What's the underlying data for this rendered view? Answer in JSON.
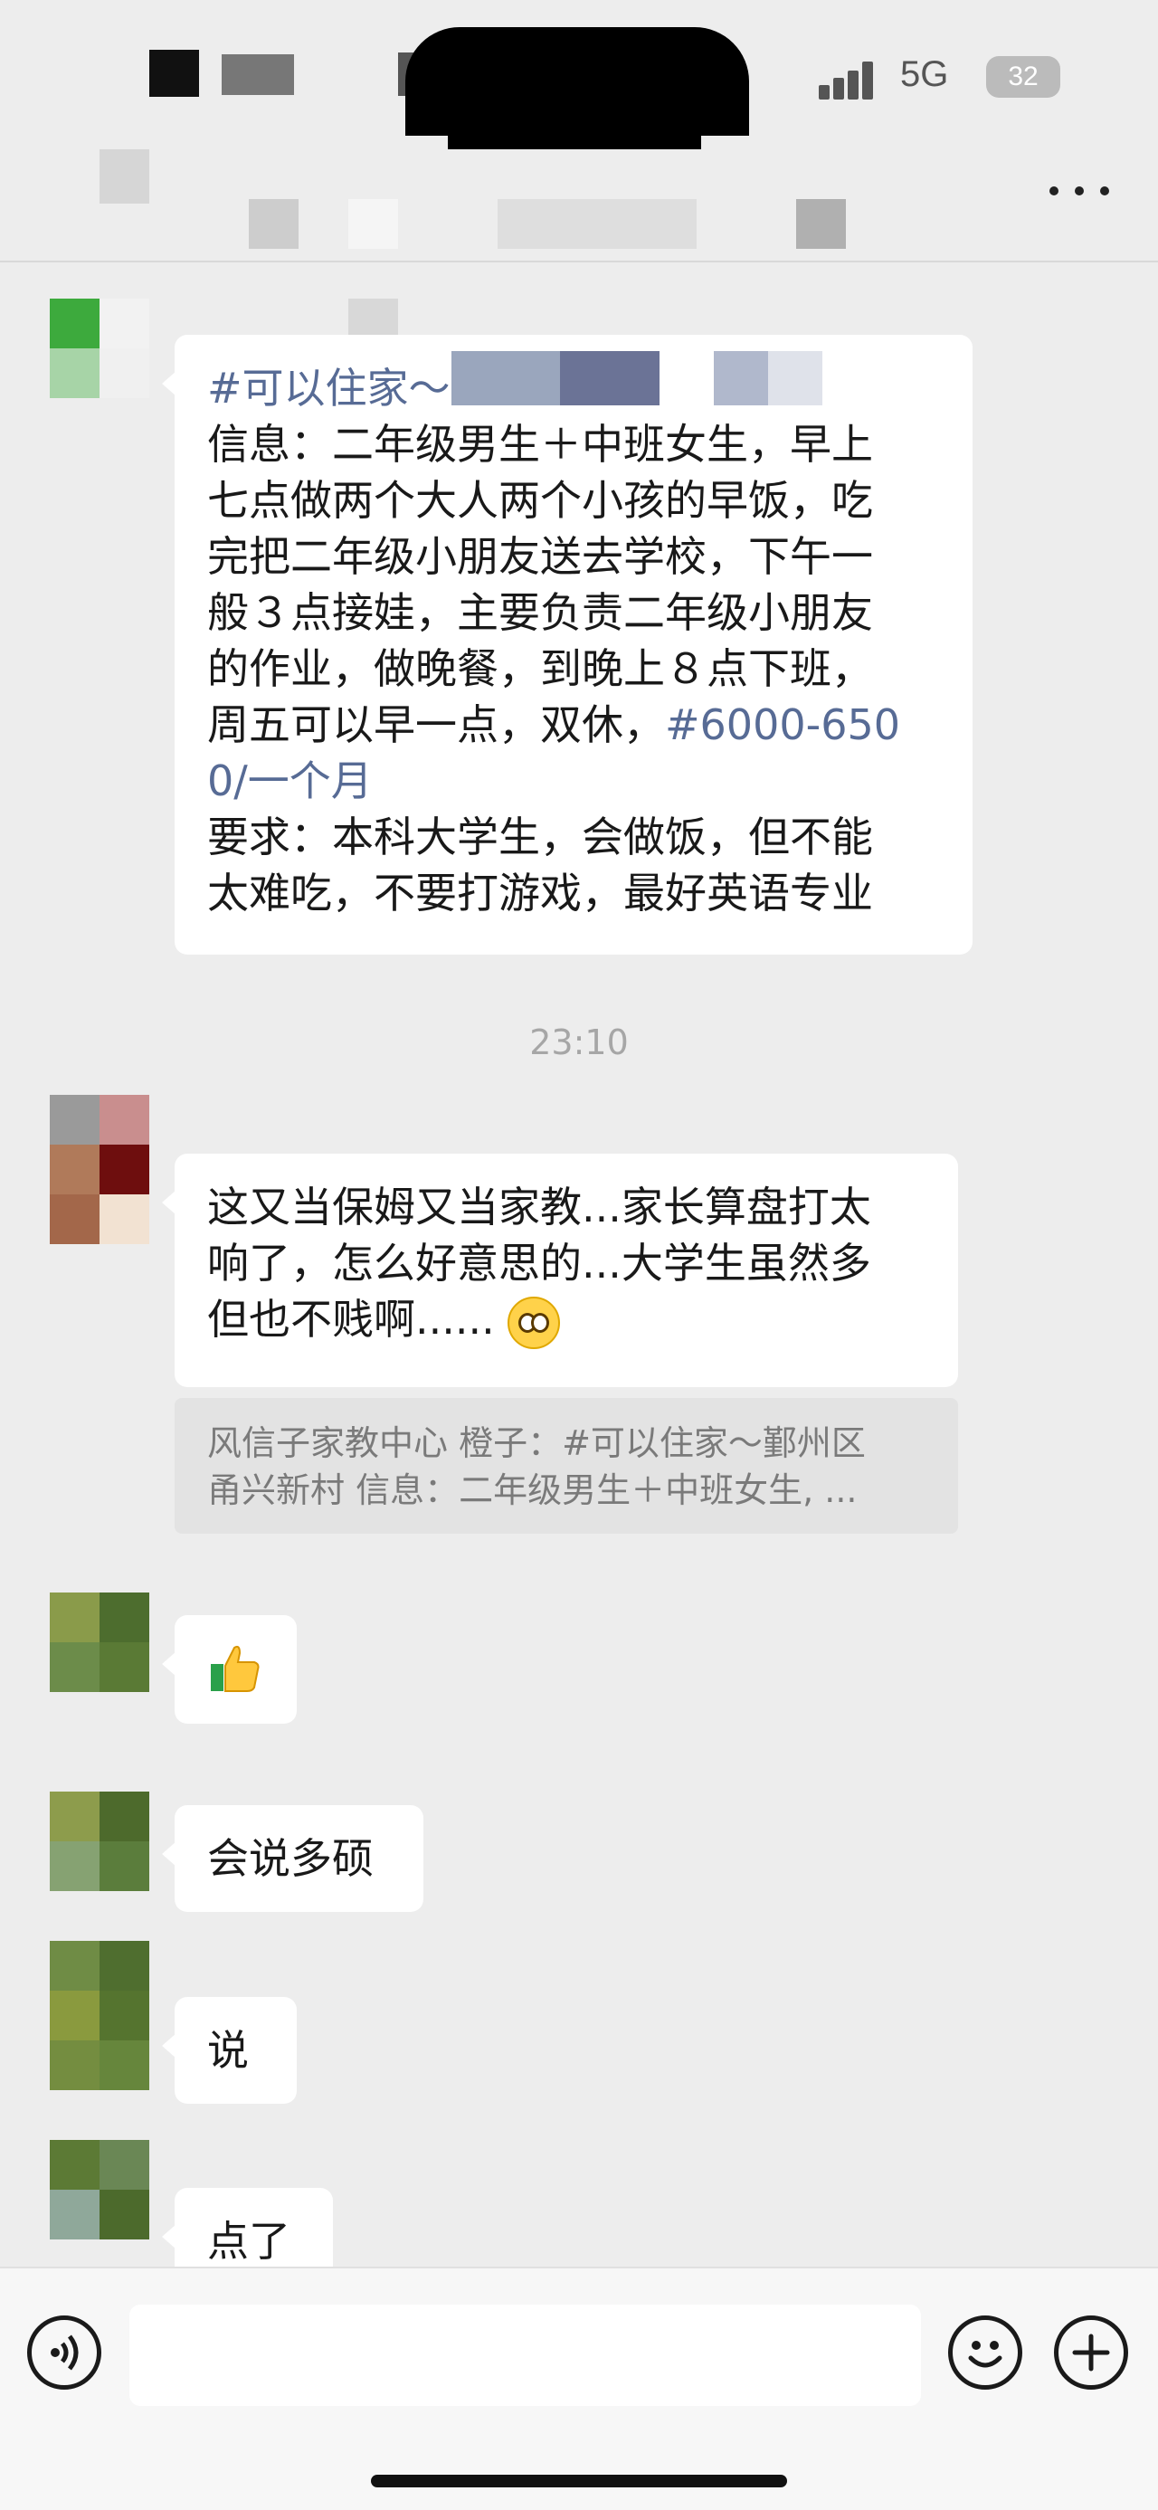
{
  "status_bar": {
    "network": "5G",
    "battery": "32"
  },
  "header": {
    "more_icon": "more-dots-icon"
  },
  "messages": [
    {
      "tag_prefix": "#可以住家～",
      "lines": [
        "信息：二年级男生＋中班女生，早上",
        "七点做两个大人两个小孩的早饭，吃",
        "完把二年级小朋友送去学校，下午一",
        "般３点接娃，主要负责二年级小朋友",
        "的作业，做晚餐，到晚上８点下班，",
        "周五可以早一点，双休，"
      ],
      "salary_a": "#6000-650",
      "salary_b": "0/一个月",
      "requirements": [
        "要求：本科大学生，会做饭，但不能",
        "太难吃，不要打游戏，最好英语专业"
      ]
    }
  ],
  "timestamp": "23:10",
  "reply": {
    "lines": [
      "这又当保姆又当家教...家长算盘打太",
      "响了，怎么好意思的...大学生虽然多",
      "但也不贱啊......"
    ],
    "emoji": "flushed-face-icon"
  },
  "quote": {
    "line1": "风信子家教中心  橙子：#可以住家～鄞州区",
    "line2": "甬兴新村 信息：二年级男生＋中班女生, ..."
  },
  "thumbs": {
    "emoji": "thumbs-up-icon"
  },
  "short_messages": [
    "会说多硕",
    "说",
    "点了"
  ],
  "input": {
    "voice_icon": "voice-icon",
    "emoji_icon": "smiley-icon",
    "add_icon": "plus-icon",
    "value": ""
  }
}
